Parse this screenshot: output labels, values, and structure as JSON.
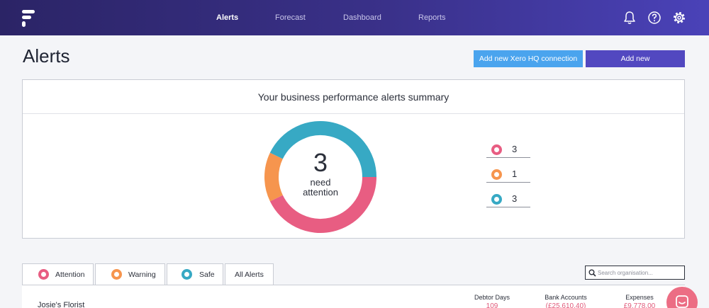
{
  "nav": {
    "items": [
      {
        "label": "Alerts",
        "active": true
      },
      {
        "label": "Forecast",
        "active": false
      },
      {
        "label": "Dashboard",
        "active": false
      },
      {
        "label": "Reports",
        "active": false
      }
    ],
    "icons": [
      "bell-icon",
      "help-icon",
      "gear-icon"
    ]
  },
  "page": {
    "title": "Alerts",
    "add_xero_label": "Add new Xero HQ connection",
    "add_new_label": "Add new"
  },
  "summary": {
    "title": "Your business performance alerts summary",
    "count": "3",
    "caption_line1": "need",
    "caption_line2": "attention",
    "segments": [
      {
        "status": "attention",
        "value": 3,
        "color": "#e85d82"
      },
      {
        "status": "warning",
        "value": 1,
        "color": "#f6954e"
      },
      {
        "status": "safe",
        "value": 3,
        "color": "#37a9c4"
      }
    ],
    "legend": [
      {
        "value": "3",
        "color": "#e85d82"
      },
      {
        "value": "1",
        "color": "#f6954e"
      },
      {
        "value": "3",
        "color": "#37a9c4"
      }
    ]
  },
  "tabs": [
    {
      "label": "Attention",
      "color": "#e85d82",
      "active": true
    },
    {
      "label": "Warning",
      "color": "#f6954e",
      "active": false
    },
    {
      "label": "Safe",
      "color": "#37a9c4",
      "active": false
    },
    {
      "label": "All Alerts",
      "color": "",
      "active": false
    }
  ],
  "search": {
    "placeholder": "Search organisation..."
  },
  "organisation": {
    "name": "Josie's Florist",
    "metrics": [
      {
        "label": "Debtor Days",
        "value": "109"
      },
      {
        "label": "Bank Accounts",
        "value": "(£25,610.40)"
      },
      {
        "label": "Expenses",
        "value": "£9,778.00"
      }
    ]
  },
  "colors": {
    "accent": "#5248c0",
    "xero_button": "#4aa4ee",
    "chat": "#ec6d84"
  }
}
